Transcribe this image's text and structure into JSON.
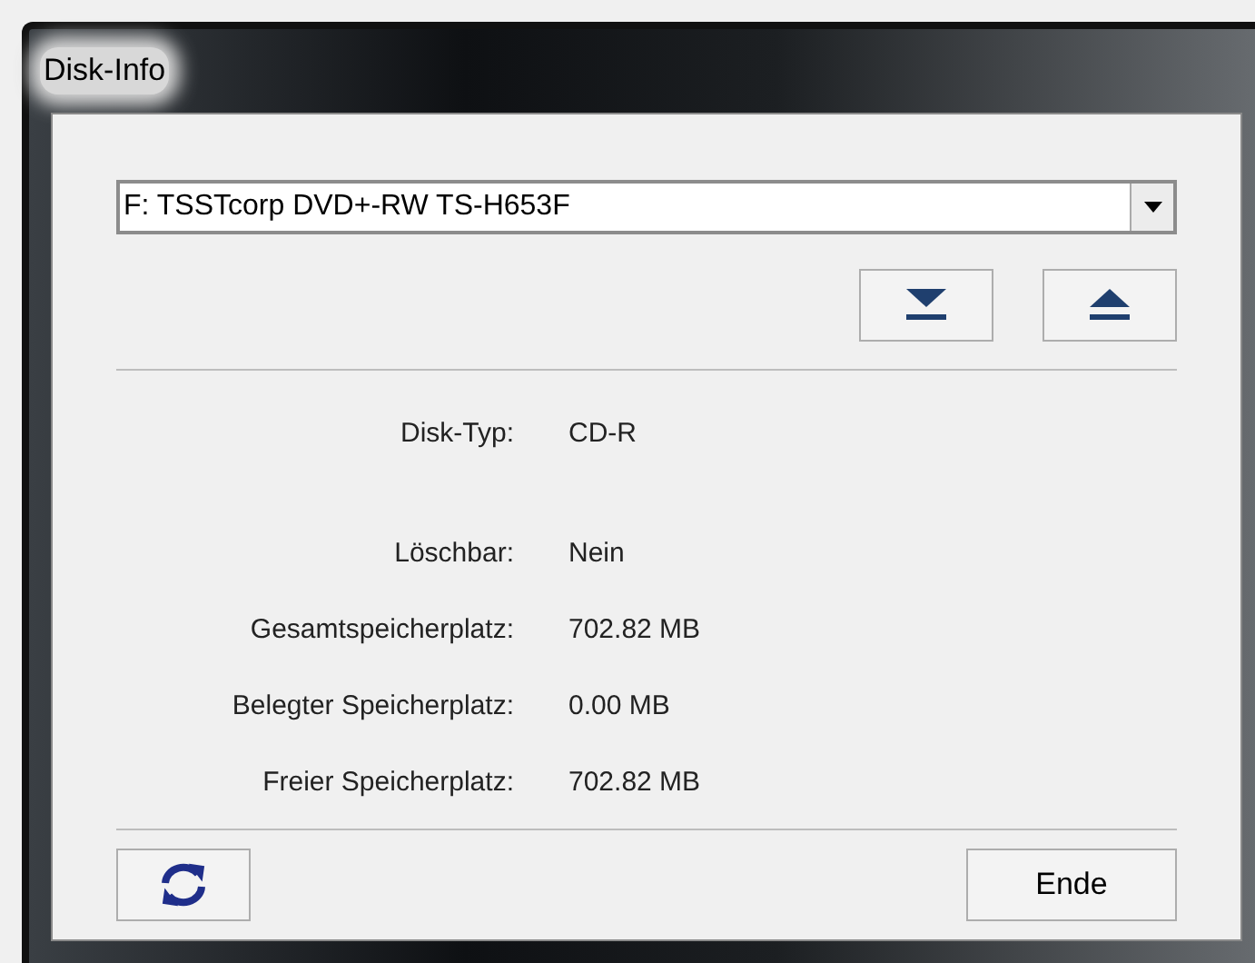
{
  "window": {
    "title": "Disk-Info"
  },
  "drive_select": {
    "value": "F: TSSTcorp DVD+-RW TS-H653F"
  },
  "info_rows": [
    {
      "label": "Disk-Typ:",
      "value": "CD-R"
    },
    {
      "label": "Löschbar:",
      "value": "Nein"
    },
    {
      "label": "Gesamtspeicherplatz:",
      "value": "702.82 MB"
    },
    {
      "label": "Belegter Speicherplatz:",
      "value": "0.00 MB"
    },
    {
      "label": "Freier Speicherplatz:",
      "value": "702.82 MB"
    }
  ],
  "buttons": {
    "close": "Ende"
  }
}
